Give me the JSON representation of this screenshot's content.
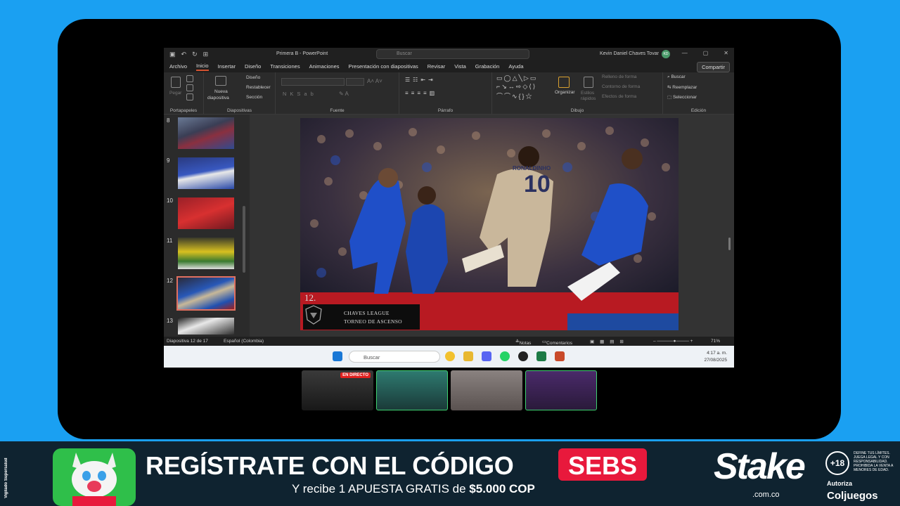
{
  "app": {
    "title": "Primera B - PowerPoint",
    "search_placeholder": "Buscar",
    "user_name": "Kevin Daniel Chaves Tovar",
    "user_initials": "KD",
    "window_controls": [
      "—",
      "▢",
      "✕"
    ]
  },
  "ribbon_tabs": [
    "Archivo",
    "Inicio",
    "Insertar",
    "Diseño",
    "Transiciones",
    "Animaciones",
    "Presentación con diapositivas",
    "Revisar",
    "Vista",
    "Grabación",
    "Ayuda"
  ],
  "active_tab": "Inicio",
  "share_label": "Compartir",
  "ribbon": {
    "groups": [
      "Portapapeles",
      "Diapositivas",
      "Fuente",
      "Párrafo",
      "Dibujo",
      "Edición"
    ],
    "paste_label": "Pegar",
    "new_slide_line1": "Nueva",
    "new_slide_line2": "diapositiva",
    "layout_label": "Diseño",
    "reset_label": "Restablecer",
    "section_label": "Sección",
    "arrange_label": "Organizar",
    "quick_styles_line1": "Estilos",
    "quick_styles_line2": "rápidos",
    "shape_fill": "Relleno de forma",
    "shape_outline": "Contorno de forma",
    "shape_effects": "Efectos de forma",
    "find_label": "Buscar",
    "replace_label": "Reemplazar",
    "select_label": "Seleccionar"
  },
  "thumbnails": [
    {
      "num": "8"
    },
    {
      "num": "9"
    },
    {
      "num": "10"
    },
    {
      "num": "11"
    },
    {
      "num": "12"
    },
    {
      "num": "13"
    }
  ],
  "selected_slide": "12",
  "slide": {
    "number": "12.",
    "league_line1": "CHAVES LEAGUE",
    "league_line2": "TORNEO DE ASCENSO",
    "player_number": "10",
    "player_name": "RONALDINHO"
  },
  "statusbar": {
    "slide_info": "Diapositiva 12 de 17",
    "language": "Español (Colombia)",
    "notes": "Notas",
    "comments": "Comentarios",
    "zoom": "71%"
  },
  "taskbar": {
    "search_placeholder": "Buscar",
    "time": "4:17 a. m.",
    "date": "27/08/2025"
  },
  "cams": {
    "live_label": "EN DIRECTO"
  },
  "banner": {
    "vigilado": "Vigilado Supersalud",
    "headline": "REGÍSTRATE CON EL CÓDIGO",
    "code": "SEBS",
    "subline_prefix": "Y recibe 1 APUESTA GRATIS de",
    "subline_amount": "$5.000 COP",
    "brand": "Stake",
    "brand_domain": ".com.co",
    "age": "+18",
    "legal": "DEFINE TUS LÍMITES. JUEGA LEGAL Y CON RESPONSABILIDAD. PROHIBIDA LA VENTA A MENORES DE EDAD.",
    "autoriza": "Autoriza",
    "coljuegos": "Coljuegos"
  },
  "colors": {
    "background": "#1aa0f2",
    "ppt_accent": "#d35230",
    "code_badge": "#e8193c",
    "banner_bg": "#0f2330"
  }
}
